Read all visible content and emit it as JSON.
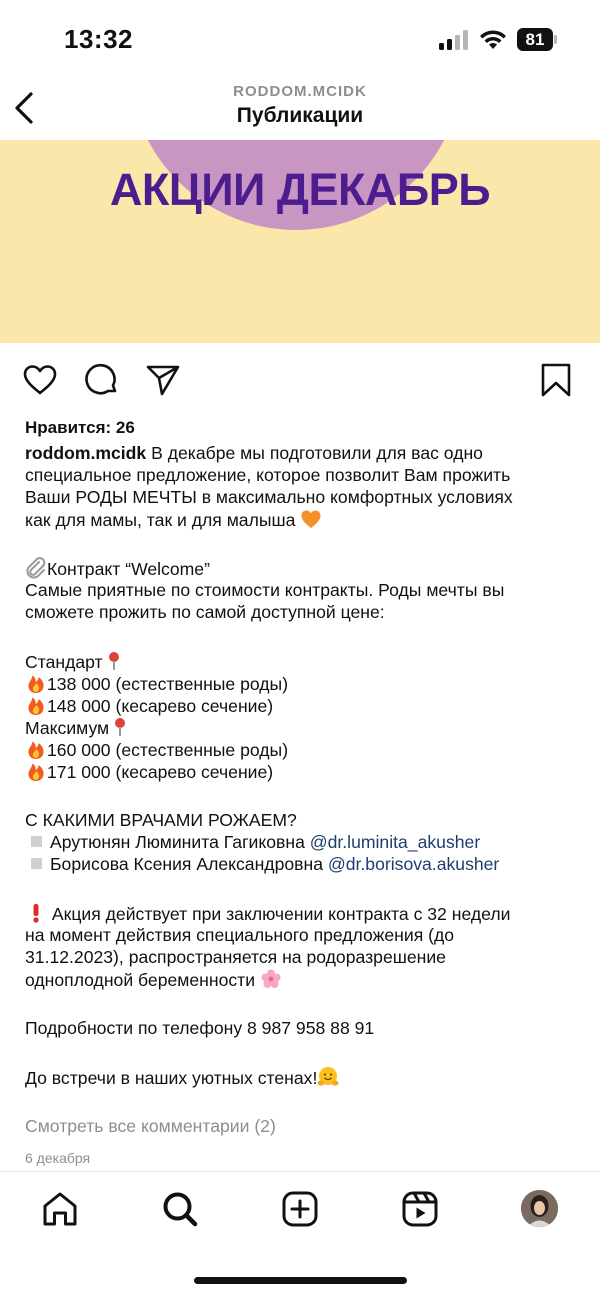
{
  "status_bar": {
    "time": "13:32",
    "battery": "81"
  },
  "header": {
    "account": "RODDOM.MCIDK",
    "title": "Публикации"
  },
  "post_image": {
    "text": "АКЦИИ ДЕКАБРЬ",
    "colors": {
      "background": "#fbe7a9",
      "blob": "#c996c3",
      "text": "#4c1d8e"
    }
  },
  "actions": {
    "like_icon": "heart-icon",
    "comment_icon": "comment-icon",
    "share_icon": "paper-plane-icon",
    "save_icon": "bookmark-icon"
  },
  "post": {
    "likes": "Нравится: 26",
    "author": "roddom.mcidk",
    "intro_1": " В декабре мы подготовили для вас одно",
    "intro_2": "специальное предложение, которое позволит Вам прожить",
    "intro_3": "Ваши РОДЫ МЕЧТЫ в максимально комфортных условиях",
    "intro_4": "как для мамы, так и для малыша ",
    "contract_title": "Контракт “Welcome”",
    "contract_desc_1": "Самые приятные по стоимости контракты. Роды мечты вы",
    "contract_desc_2": "сможете прожить по самой доступной цене:",
    "standard_label": "Стандарт",
    "standard_natural": "138 000 (естественные роды)",
    "standard_cesarean": "148 000 (кесарево сечение)",
    "maximum_label": "Максимум",
    "maximum_natural": "160 000 (естественные роды)",
    "maximum_cesarean": "171 000 (кесарево сечение)",
    "doctors_heading": "С КАКИМИ ВРАЧАМИ РОЖАЕМ?",
    "doctor_1_name": "Арутюнян Люминита Гагиковна ",
    "doctor_1_handle": "@dr.luminita_akusher",
    "doctor_2_name": "Борисова Ксения Александровна ",
    "doctor_2_handle": "@dr.borisova.akusher",
    "terms_1": " Акция действует при заключении контракта с 32 недели",
    "terms_2": "на момент действия специального предложения (до",
    "terms_3": "31.12.2023), распространяется на родоразрешение",
    "terms_4": "одноплодной беременности ",
    "phone_line": "Подробности по телефону 8 987 958 88 91",
    "closing": "До встречи в наших уютных стенах!",
    "view_comments": "Смотреть все комментарии (2)",
    "date": "6 декабря"
  },
  "bottom_nav": {
    "items": [
      "home-icon",
      "search-icon",
      "create-icon",
      "reels-icon",
      "profile-avatar"
    ]
  }
}
